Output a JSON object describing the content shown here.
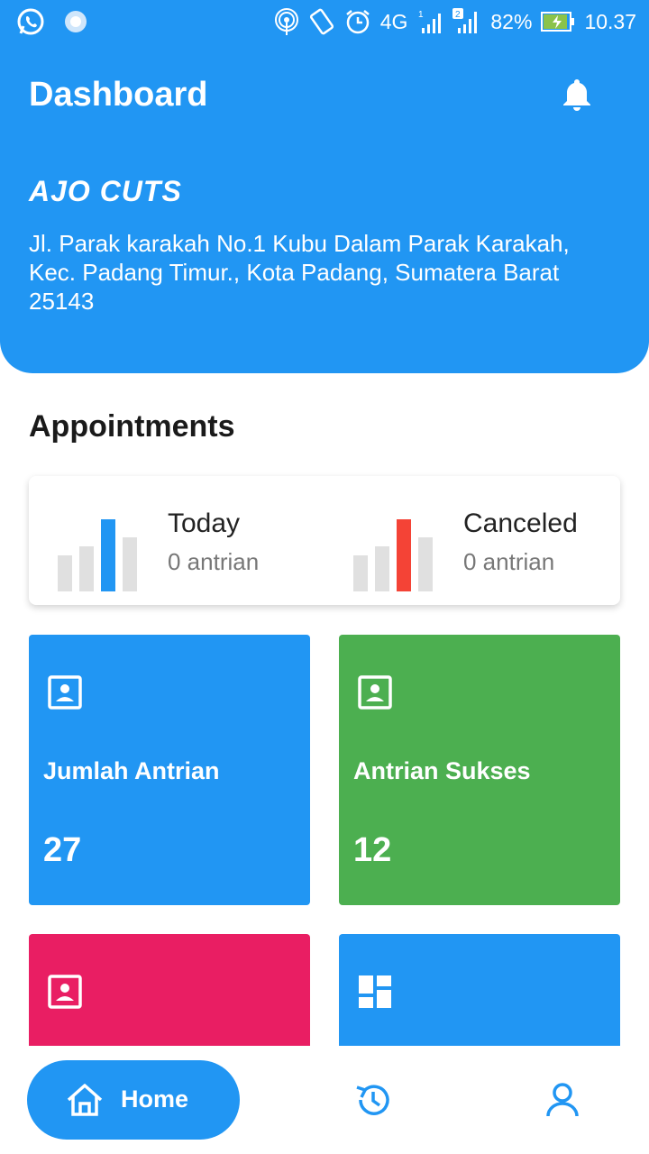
{
  "status_bar": {
    "signal_label_4g": "4G",
    "sim1": "1",
    "sim2": "2",
    "battery": "82%",
    "time": "10.37"
  },
  "header": {
    "title": "Dashboard",
    "brand": "AJO CUTS",
    "address": "Jl. Parak karakah No.1 Kubu Dalam Parak Karakah, Kec. Padang Timur., Kota Padang, Sumatera Barat 25143"
  },
  "appointments": {
    "section_title": "Appointments",
    "today_label": "Today",
    "today_value": "0 antrian",
    "canceled_label": "Canceled",
    "canceled_value": "0 antrian"
  },
  "tiles": [
    {
      "label": "Jumlah Antrian",
      "value": "27",
      "color": "#2196f3"
    },
    {
      "label": "Antrian Sukses",
      "value": "12",
      "color": "#4caf50"
    },
    {
      "label": "",
      "value": "",
      "color": "#e91e63"
    },
    {
      "label": "",
      "value": "",
      "color": "#2196f3"
    }
  ],
  "bottom_nav": {
    "home_label": "Home",
    "items": [
      "home-icon",
      "history-icon",
      "profile-icon"
    ]
  },
  "colors": {
    "primary": "#2196f3",
    "success": "#4caf50",
    "danger": "#f44336",
    "pink": "#e91e63"
  }
}
